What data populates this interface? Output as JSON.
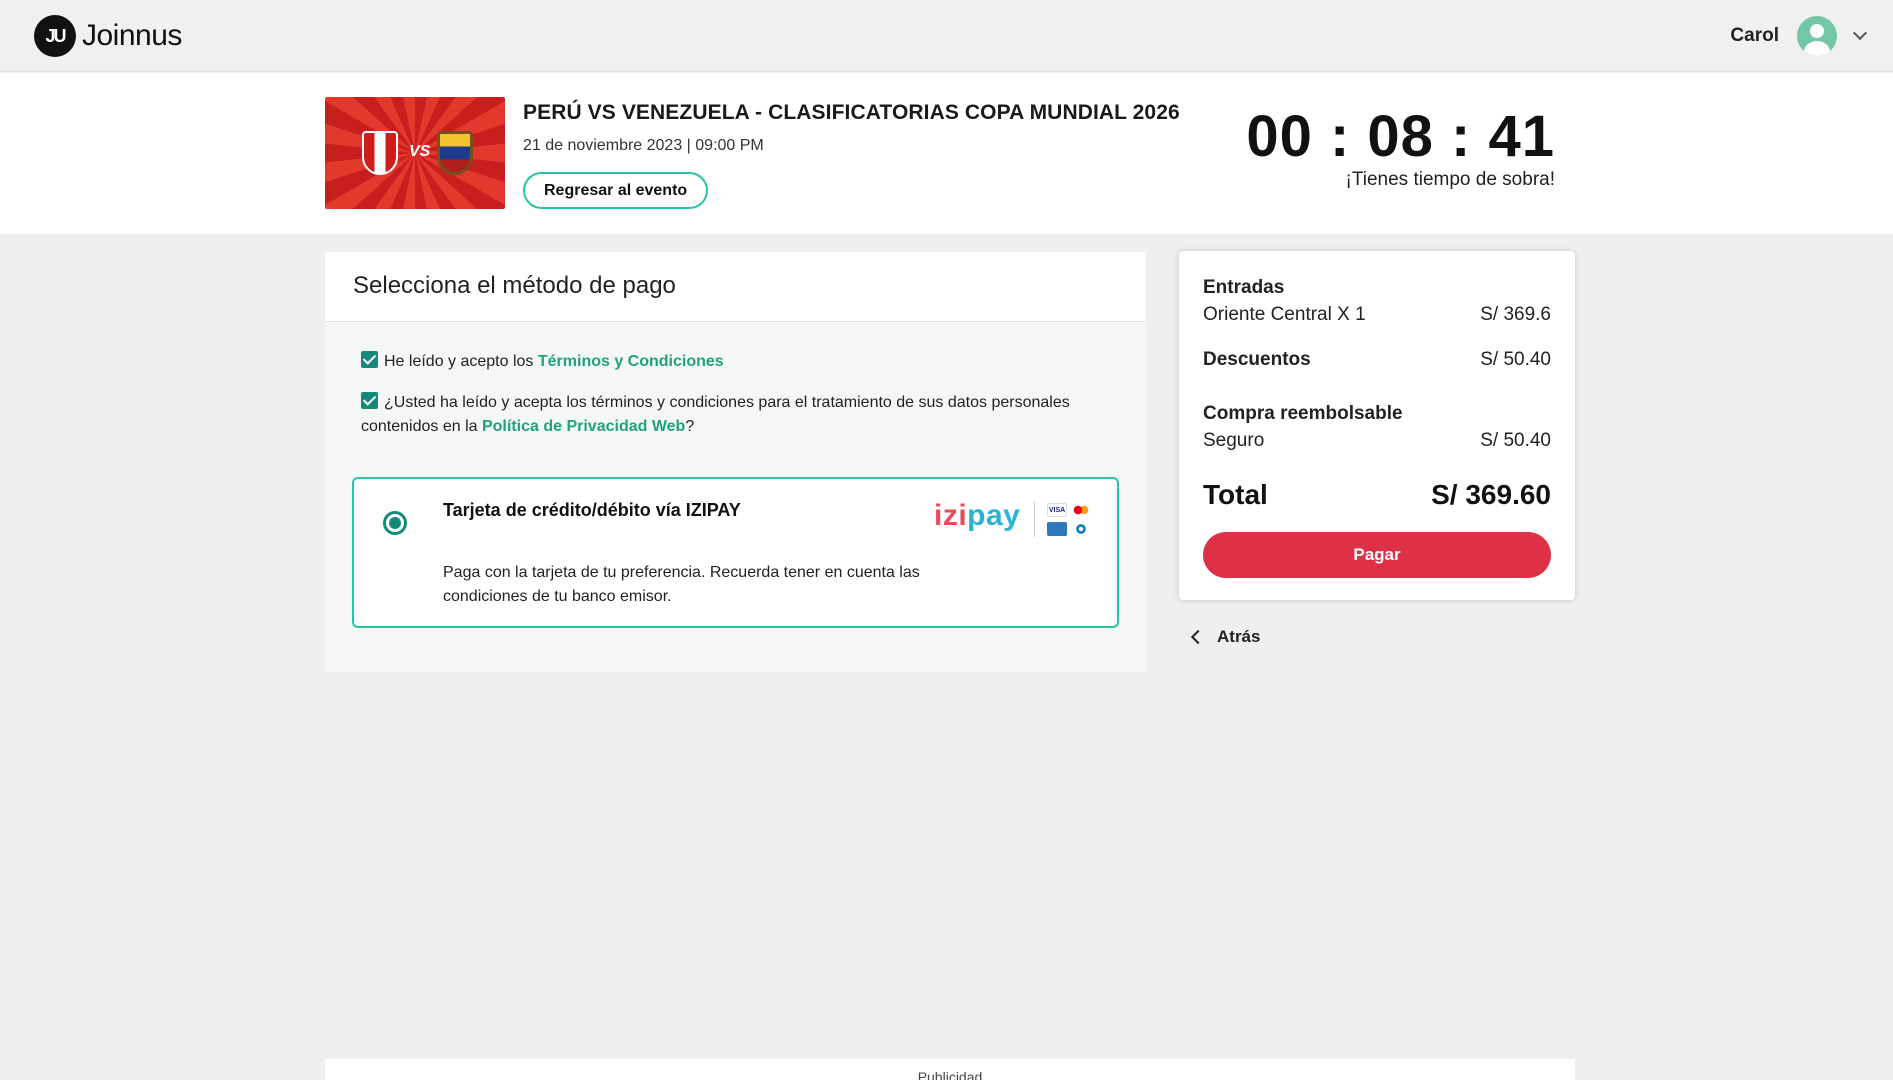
{
  "header": {
    "logo_mark": "JU",
    "logo_text": "Joinnus",
    "user_name": "Carol"
  },
  "event": {
    "title": "PERÚ VS VENEZUELA - CLASIFICATORIAS COPA MUNDIAL 2026",
    "date": "21 de noviembre 2023 | 09:00 PM",
    "back_button": "Regresar al evento",
    "image_vs": "VS",
    "timer": "00 : 08 : 41",
    "timer_message": "¡Tienes tiempo de sobra!"
  },
  "payment": {
    "heading": "Selecciona el método de pago",
    "terms_prefix": "He leído y acepto los ",
    "terms_link": "Términos y Condiciones",
    "privacy_prefix": "¿Usted ha leído y acepta los términos y condiciones para el tratamiento de sus datos personales contenidos en la ",
    "privacy_link": "Política de Privacidad Web",
    "privacy_suffix": "?",
    "method": {
      "title": "Tarjeta de crédito/débito vía IZIPAY",
      "description": "Paga con la tarjeta de tu preferencia. Recuerda tener en cuenta las condiciones de tu banco emisor.",
      "brand_izi": "izi",
      "brand_pay": "pay",
      "visa": "VISA"
    }
  },
  "summary": {
    "tickets_label": "Entradas",
    "ticket_name": "Oriente Central X 1",
    "ticket_price": "S/ 369.6",
    "discounts_label": "Descuentos",
    "discounts_value": "S/ 50.40",
    "refund_label": "Compra reembolsable",
    "insurance_label": "Seguro",
    "insurance_value": "S/ 50.40",
    "total_label": "Total",
    "total_value": "S/ 369.60",
    "pay_button": "Pagar",
    "back_link": "Atrás"
  },
  "ads_label": "Publicidad",
  "colors": {
    "accent": "#2bc2a6",
    "checkbox": "#138a7a",
    "pay_button": "#df3145",
    "link": "#1ea37e"
  }
}
